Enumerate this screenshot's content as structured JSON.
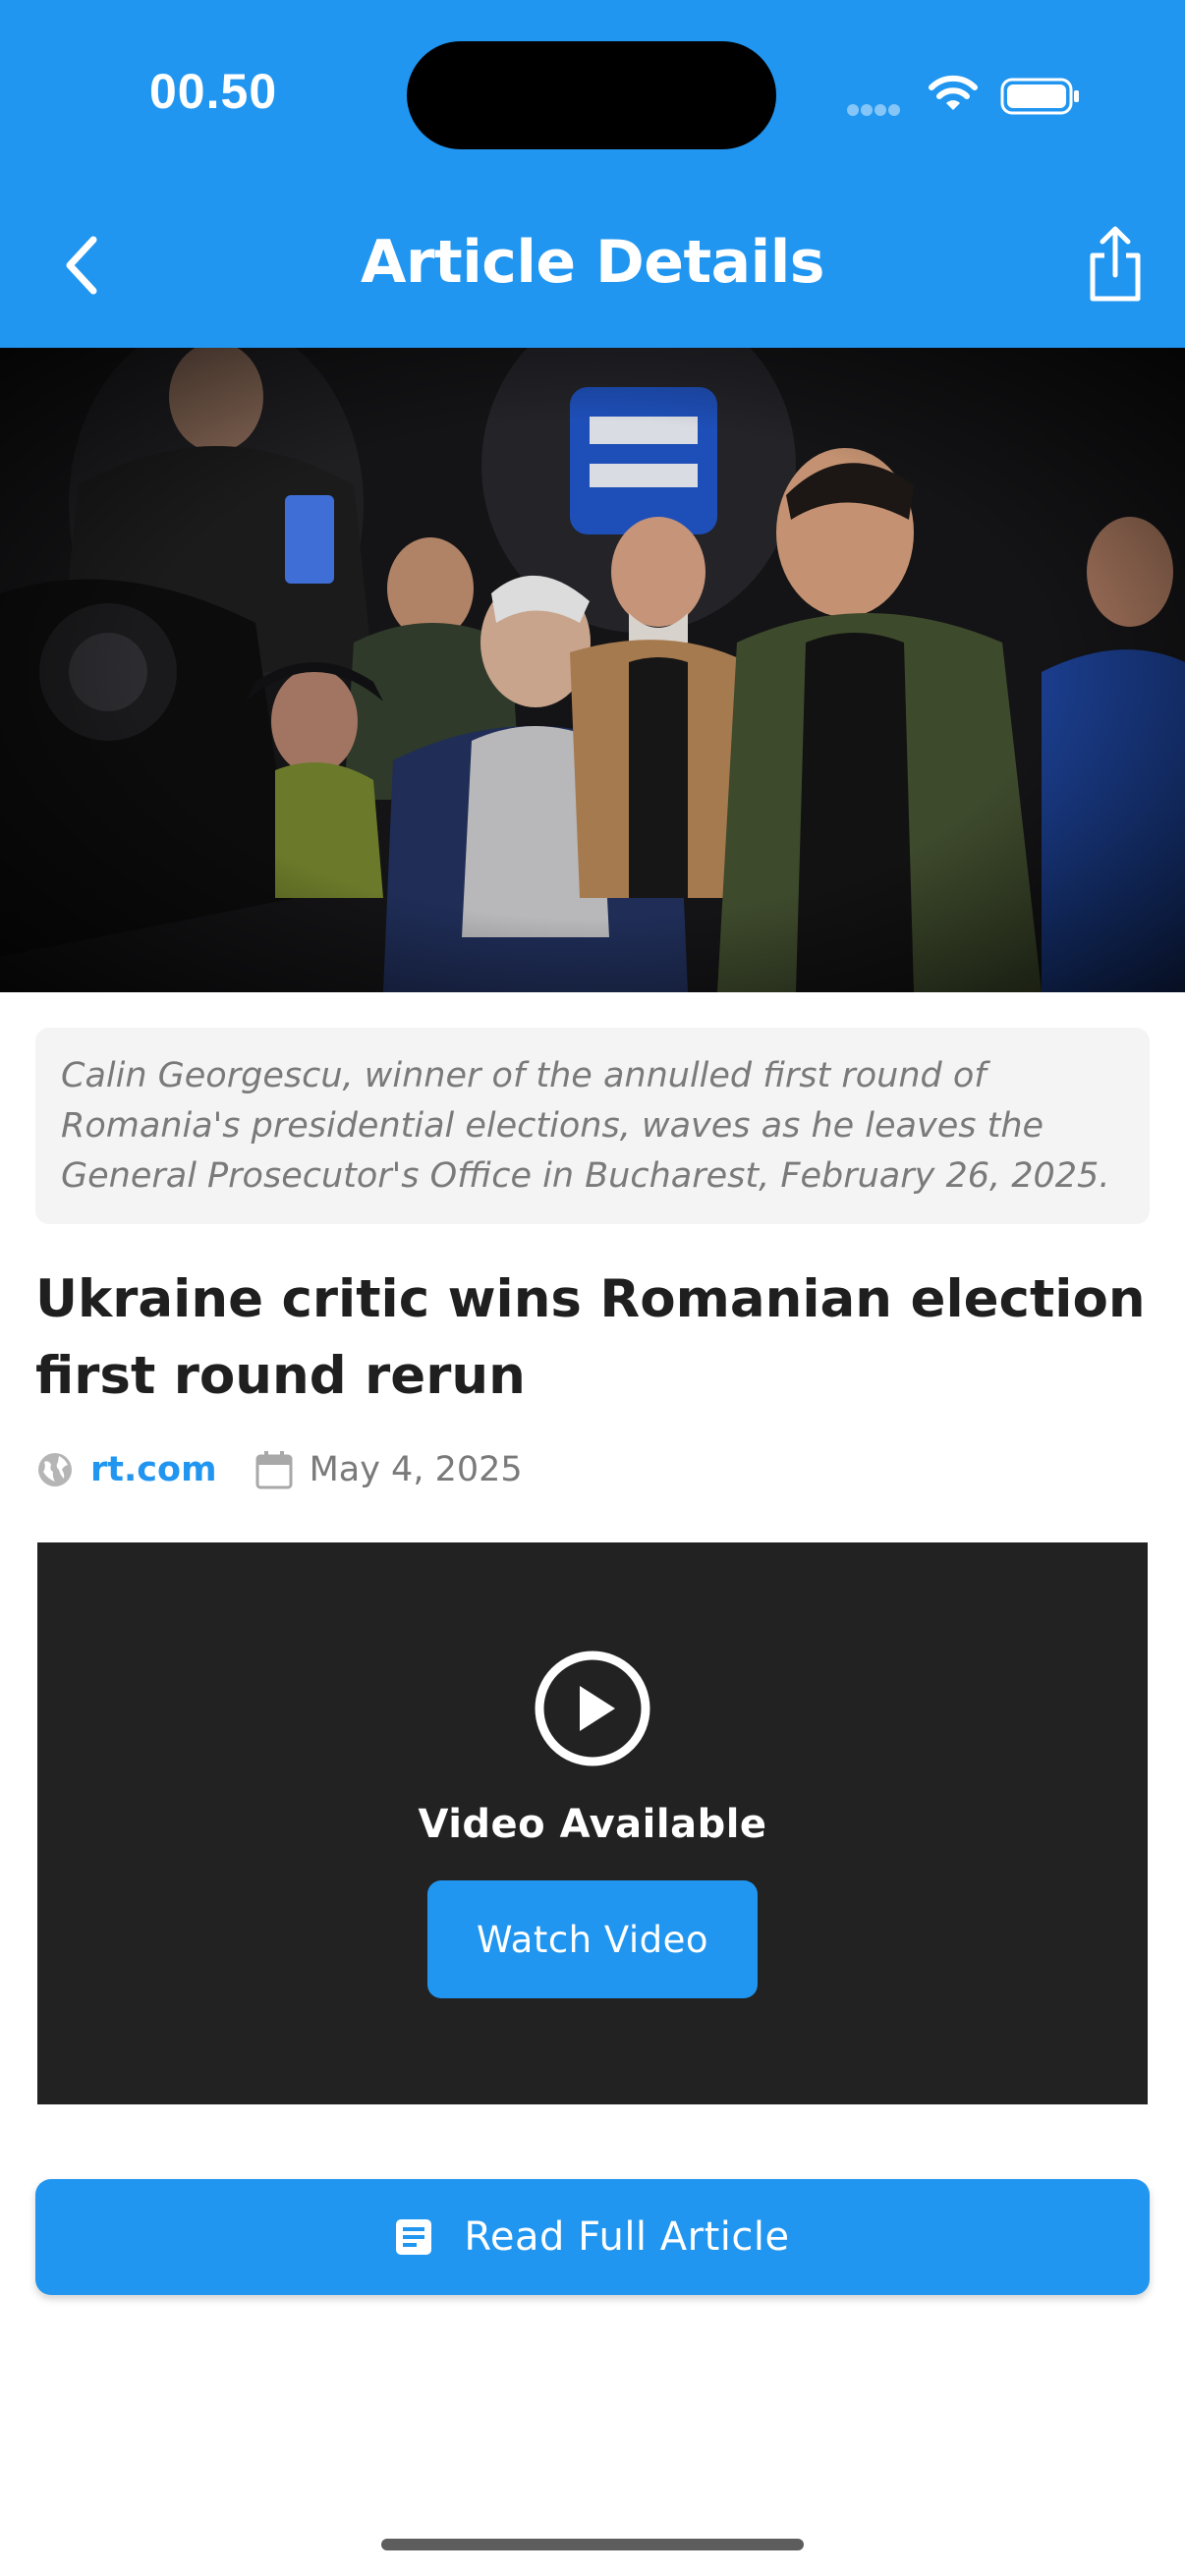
{
  "status_bar": {
    "time": "00.50",
    "icons": [
      "cellular-signal-icon",
      "wifi-icon",
      "battery-icon"
    ]
  },
  "header": {
    "title": "Article Details",
    "back_icon": "chevron-left-icon",
    "share_icon": "share-icon",
    "background": "#2196f0"
  },
  "article": {
    "image_caption": "Calin Georgescu, winner of the annulled first round of Romania's presidential elections, waves as he leaves the General Prosecutor's Office in Bucharest, February 26, 2025.",
    "caption_lines": [
      "Calin Georgescu, winner of the annulled first round of",
      "Romania's presidential elections, waves as he leaves the",
      "General Prosecutor's Office in Bucharest, February 26, 2025."
    ],
    "title_lines": [
      "Ukraine critic wins Romanian election",
      "first round rerun"
    ],
    "source": "rt.com",
    "date": "May 4, 2025"
  },
  "video": {
    "label": "Video Available",
    "button_label": "Watch Video",
    "icon": "play-circle-icon"
  },
  "actions": {
    "read_full_label": "Read Full Article",
    "read_full_icon": "article-icon"
  },
  "colors": {
    "accent": "#2196f0",
    "video_bg": "#222222",
    "caption_bg": "#f4f4f4"
  }
}
